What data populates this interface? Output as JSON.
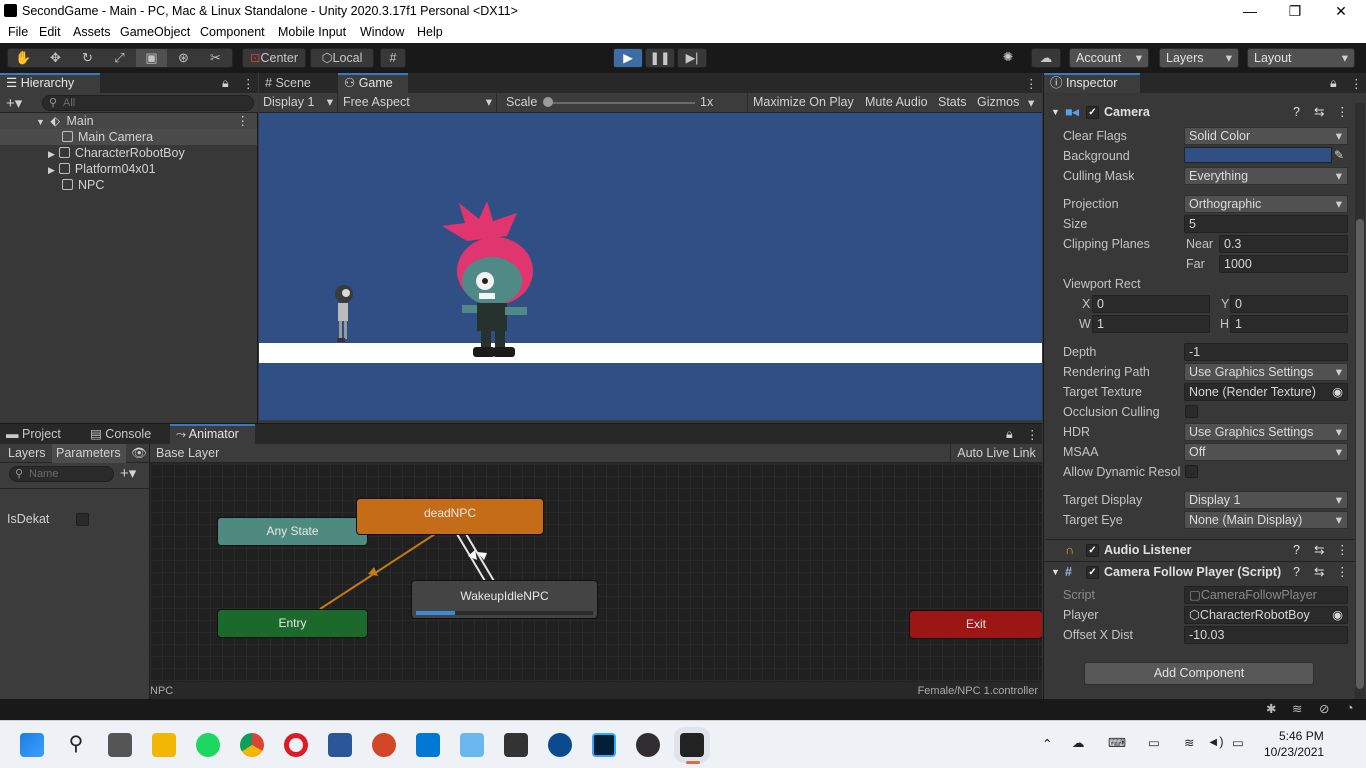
{
  "window": {
    "title": "SecondGame - Main - PC, Mac & Linux Standalone - Unity 2020.3.17f1 Personal <DX11>"
  },
  "menu": [
    "File",
    "Edit",
    "Assets",
    "GameObject",
    "Component",
    "Mobile Input",
    "Window",
    "Help"
  ],
  "toolbar": {
    "pivot": "Center",
    "space": "Local",
    "account": "Account",
    "layers": "Layers",
    "layout": "Layout"
  },
  "hierarchy": {
    "tab": "Hierarchy",
    "search_placeholder": "All",
    "scene": "Main",
    "items": [
      "Main Camera",
      "CharacterRobotBoy",
      "Platform04x01",
      "NPC"
    ]
  },
  "game": {
    "tabs": [
      "Scene",
      "Game"
    ],
    "display": "Display 1",
    "aspect": "Free Aspect",
    "scale_label": "Scale",
    "scale_value": "1x",
    "options": [
      "Maximize On Play",
      "Mute Audio",
      "Stats",
      "Gizmos"
    ],
    "background_color": "#2f4f85",
    "ground_color": "#ffffff"
  },
  "bottom": {
    "tabs": [
      "Project",
      "Console",
      "Animator"
    ],
    "layers_tab": "Layers",
    "parameters_tab": "Parameters",
    "base_layer": "Base Layer",
    "auto_live_link": "Auto Live Link",
    "name_placeholder": "Name",
    "param_name": "IsDekat",
    "states": {
      "any": "Any State",
      "entry": "Entry",
      "dead": "deadNPC",
      "wakeup": "WakeupIdleNPC",
      "exit": "Exit"
    },
    "wakeup_progress": 0.22,
    "footer_left": "NPC",
    "footer_right": "Female/NPC 1.controller"
  },
  "inspector": {
    "tab": "Inspector",
    "camera": {
      "title": "Camera",
      "clear_flags_label": "Clear Flags",
      "clear_flags": "Solid Color",
      "background_label": "Background",
      "background_color": "#2f4f85",
      "culling_mask_label": "Culling Mask",
      "culling_mask": "Everything",
      "projection_label": "Projection",
      "projection": "Orthographic",
      "size_label": "Size",
      "size": "5",
      "clipping_label": "Clipping Planes",
      "near_label": "Near",
      "near": "0.3",
      "far_label": "Far",
      "far": "1000",
      "viewport_label": "Viewport Rect",
      "x_label": "X",
      "x": "0",
      "y_label": "Y",
      "y": "0",
      "w_label": "W",
      "w": "1",
      "h_label": "H",
      "h": "1",
      "depth_label": "Depth",
      "depth": "-1",
      "rendering_path_label": "Rendering Path",
      "rendering_path": "Use Graphics Settings",
      "target_texture_label": "Target Texture",
      "target_texture": "None (Render Texture)",
      "occlusion_label": "Occlusion Culling",
      "hdr_label": "HDR",
      "hdr": "Use Graphics Settings",
      "msaa_label": "MSAA",
      "msaa": "Off",
      "dynamic_res_label": "Allow Dynamic Resol",
      "target_display_label": "Target Display",
      "target_display": "Display 1",
      "target_eye_label": "Target Eye",
      "target_eye": "None (Main Display)"
    },
    "audio_listener": {
      "title": "Audio Listener"
    },
    "follow": {
      "title": "Camera Follow Player (Script)",
      "script_label": "Script",
      "script": "CameraFollowPlayer",
      "player_label": "Player",
      "player": "CharacterRobotBoy",
      "offset_label": "Offset X Dist",
      "offset": "-10.03"
    },
    "add_component": "Add Component"
  },
  "taskbar": {
    "time": "5:46 PM",
    "date": "10/23/2021"
  }
}
